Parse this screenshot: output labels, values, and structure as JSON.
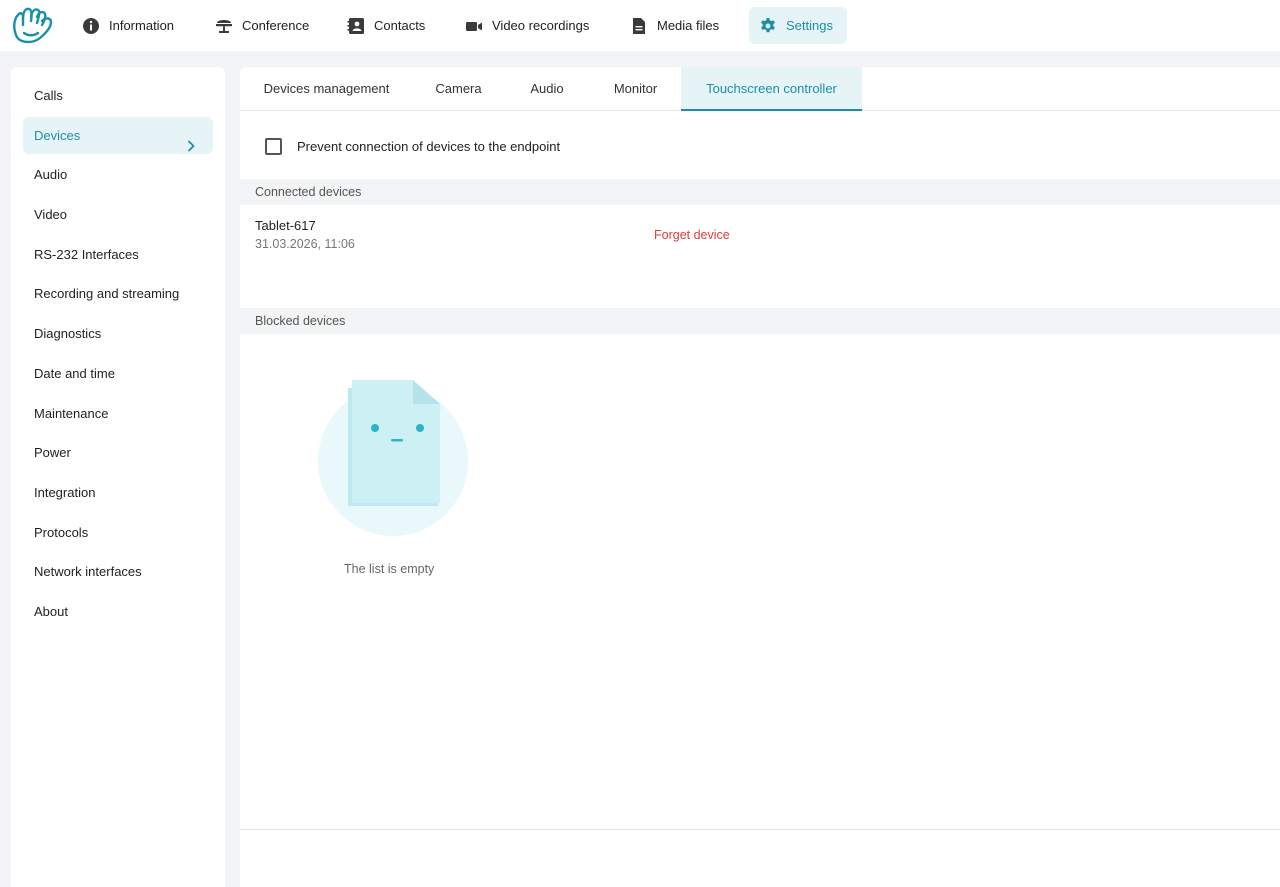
{
  "nav": {
    "items": [
      {
        "label": "Information",
        "icon": "info-icon"
      },
      {
        "label": "Conference",
        "icon": "conference-icon"
      },
      {
        "label": "Contacts",
        "icon": "contacts-icon"
      },
      {
        "label": "Video recordings",
        "icon": "video-camera-icon"
      },
      {
        "label": "Media files",
        "icon": "document-icon"
      },
      {
        "label": "Settings",
        "icon": "gear-icon",
        "active": true
      }
    ]
  },
  "sidebar": {
    "items": [
      {
        "label": "Calls"
      },
      {
        "label": "Devices",
        "active": true
      },
      {
        "label": "Audio"
      },
      {
        "label": "Video"
      },
      {
        "label": "RS-232 Interfaces"
      },
      {
        "label": "Recording and streaming"
      },
      {
        "label": "Diagnostics"
      },
      {
        "label": "Date and time"
      },
      {
        "label": "Maintenance"
      },
      {
        "label": "Power"
      },
      {
        "label": "Integration"
      },
      {
        "label": "Protocols"
      },
      {
        "label": "Network interfaces"
      },
      {
        "label": "About"
      }
    ]
  },
  "tabs": [
    {
      "label": "Devices management"
    },
    {
      "label": "Camera"
    },
    {
      "label": "Audio"
    },
    {
      "label": "Monitor"
    },
    {
      "label": "Touchscreen controller",
      "active": true
    }
  ],
  "prevent": {
    "label": "Prevent connection of devices to the endpoint",
    "checked": false
  },
  "connected": {
    "heading": "Connected devices",
    "device": {
      "name": "Tablet-617",
      "date": "31.03.2026, 11:06",
      "action": "Forget device"
    }
  },
  "blocked": {
    "heading": "Blocked devices",
    "empty_text": "The list is empty"
  },
  "colors": {
    "accent": "#1b8fa8",
    "accent_bg": "#e6f4f8",
    "danger": "#e53b3b"
  }
}
